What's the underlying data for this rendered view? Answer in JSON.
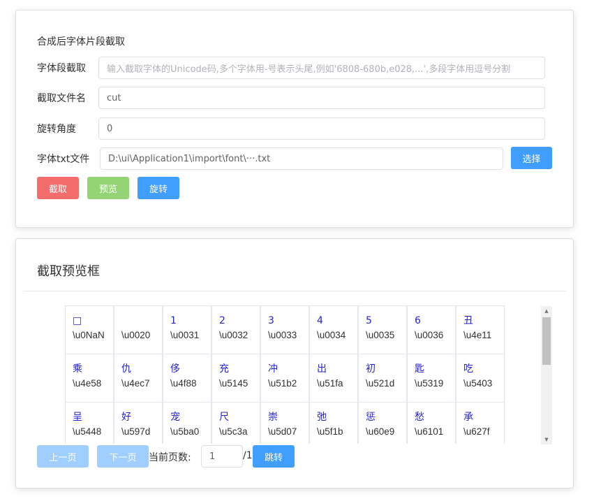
{
  "section1": {
    "title": "合成后字体片段截取",
    "rows": {
      "segment": {
        "label": "字体段截取",
        "placeholder": "输入截取字体的Unicode码,多个字体用-号表示头尾,例如'6808-680b,e028,...',多段字体用逗号分割"
      },
      "filename": {
        "label": "截取文件名",
        "value": "cut"
      },
      "rotate": {
        "label": "旋转角度",
        "value": "0"
      },
      "txtfile": {
        "label": "字体txt文件",
        "value": "D:\\ui\\Application1\\import\\font\\···.txt",
        "select_label": "选择"
      }
    },
    "buttons": {
      "cut": "截取",
      "preview": "预览",
      "rotate": "旋转"
    }
  },
  "section2": {
    "title": "截取预览框",
    "cells": [
      {
        "ch": "□",
        "code": "\\u0NaN"
      },
      {
        "ch": "",
        "code": "\\u0020"
      },
      {
        "ch": "1",
        "code": "\\u0031"
      },
      {
        "ch": "2",
        "code": "\\u0032"
      },
      {
        "ch": "3",
        "code": "\\u0033"
      },
      {
        "ch": "4",
        "code": "\\u0034"
      },
      {
        "ch": "5",
        "code": "\\u0035"
      },
      {
        "ch": "6",
        "code": "\\u0036"
      },
      {
        "ch": "丑",
        "code": "\\u4e11"
      },
      {
        "ch": "乘",
        "code": "\\u4e58"
      },
      {
        "ch": "仇",
        "code": "\\u4ec7"
      },
      {
        "ch": "侈",
        "code": "\\u4f88"
      },
      {
        "ch": "充",
        "code": "\\u5145"
      },
      {
        "ch": "冲",
        "code": "\\u51b2"
      },
      {
        "ch": "出",
        "code": "\\u51fa"
      },
      {
        "ch": "初",
        "code": "\\u521d"
      },
      {
        "ch": "匙",
        "code": "\\u5319"
      },
      {
        "ch": "吃",
        "code": "\\u5403"
      },
      {
        "ch": "呈",
        "code": "\\u5448"
      },
      {
        "ch": "好",
        "code": "\\u597d"
      },
      {
        "ch": "宠",
        "code": "\\u5ba0"
      },
      {
        "ch": "尺",
        "code": "\\u5c3a"
      },
      {
        "ch": "崇",
        "code": "\\u5d07"
      },
      {
        "ch": "弛",
        "code": "\\u5f1b"
      },
      {
        "ch": "惩",
        "code": "\\u60e9"
      },
      {
        "ch": "愁",
        "code": "\\u6101"
      },
      {
        "ch": "承",
        "code": "\\u627f"
      }
    ],
    "pager": {
      "prev": "上一页",
      "next": "下一页",
      "current_label": "当前页数:",
      "current_value": "1",
      "total": "/1",
      "jump": "跳转"
    }
  }
}
